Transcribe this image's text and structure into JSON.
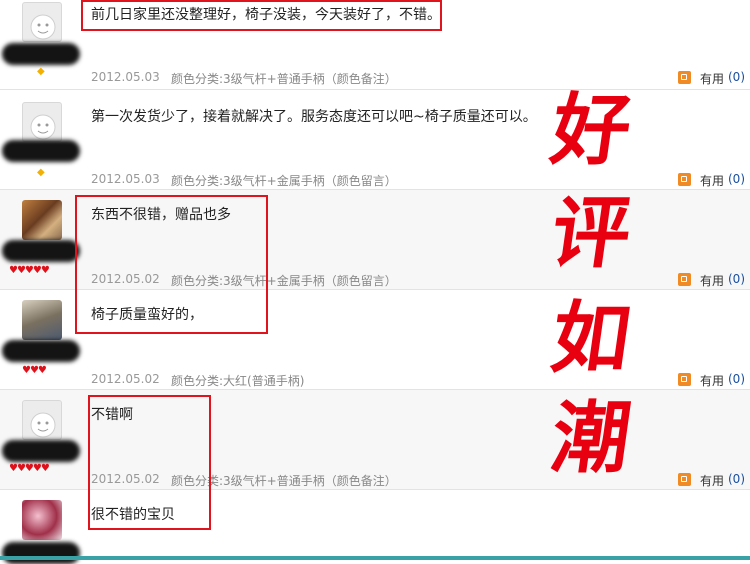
{
  "reviews": [
    {
      "text": "前几日家里还没整理好，椅子没装，今天装好了，不错。",
      "date": "2012.05.03",
      "meta": "颜色分类:3级气杆+普通手柄（颜色备注）",
      "useful_label": "有用",
      "useful_count": "(0)",
      "avatar": "default",
      "rank": "diamond",
      "rank_glyphs": "◆"
    },
    {
      "text": "第一次发货少了，接着就解决了。服务态度还可以吧~椅子质量还可以。",
      "date": "2012.05.03",
      "meta": "颜色分类:3级气杆+金属手柄（颜色留言）",
      "useful_label": "有用",
      "useful_count": "(0)",
      "avatar": "default",
      "rank": "diamond",
      "rank_glyphs": "◆"
    },
    {
      "text": "东西不很错，赠品也多",
      "date": "2012.05.02",
      "meta": "颜色分类:3级气杆+金属手柄（颜色留言）",
      "useful_label": "有用",
      "useful_count": "(0)",
      "avatar": "photo1",
      "rank": "hearts",
      "rank_glyphs": "♥♥♥♥♥"
    },
    {
      "text": "椅子质量蛮好的，",
      "date": "2012.05.02",
      "meta": "颜色分类:大红(普通手柄)",
      "useful_label": "有用",
      "useful_count": "(0)",
      "avatar": "photo2",
      "rank": "hearts",
      "rank_glyphs": "♥♥♥"
    },
    {
      "text": "不错啊",
      "date": "2012.05.02",
      "meta": "颜色分类:3级气杆+普通手柄（颜色备注）",
      "useful_label": "有用",
      "useful_count": "(0)",
      "avatar": "default",
      "rank": "hearts",
      "rank_glyphs": "♥♥♥♥♥"
    },
    {
      "text": "很不错的宝贝",
      "date": "",
      "meta": "",
      "useful_label": "",
      "useful_count": "",
      "avatar": "photo3",
      "rank": "",
      "rank_glyphs": ""
    }
  ],
  "overlay": {
    "chars": [
      "好",
      "评",
      "如",
      "潮"
    ],
    "color": "#e80010"
  },
  "colors": {
    "highlight": "#e0141c",
    "link": "#1a4fa0",
    "accent": "#f08a24"
  }
}
